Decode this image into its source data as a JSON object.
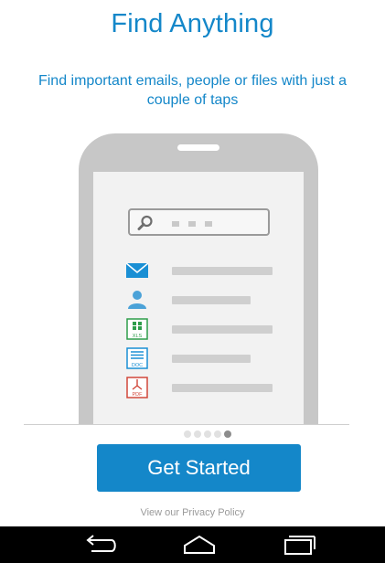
{
  "onboarding": {
    "title": "Find Anything",
    "subtitle": "Find important emails, people or files with just a couple of taps",
    "cta_label": "Get Started",
    "privacy_link": "View our Privacy Policy",
    "page_indicator": {
      "total": 5,
      "current": 5
    }
  },
  "illustration": {
    "items": [
      {
        "icon": "mail-icon"
      },
      {
        "icon": "person-icon"
      },
      {
        "icon": "xls-file-icon",
        "badge": "XLS"
      },
      {
        "icon": "doc-file-icon",
        "badge": "DOC"
      },
      {
        "icon": "pdf-file-icon",
        "badge": "PDF"
      }
    ]
  },
  "navbar": {
    "buttons": [
      "back-icon",
      "home-icon",
      "recent-apps-icon"
    ]
  },
  "colors": {
    "accent": "#1487c9",
    "xls": "#2e9d4b",
    "pdf": "#d1473a",
    "nav_bar": "#000000"
  }
}
